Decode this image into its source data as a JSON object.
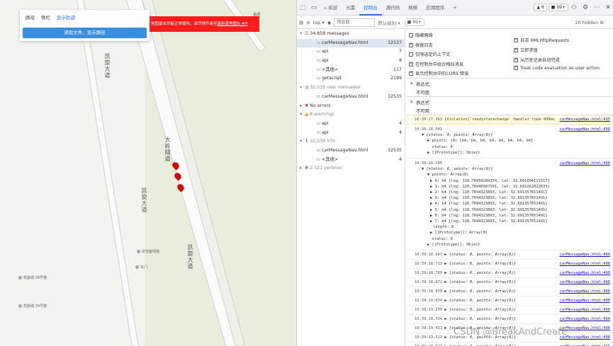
{
  "map": {
    "tabs": [
      "路径",
      "侧栏",
      "显示轨迹"
    ],
    "read_button": "读取文件，显示路径",
    "notice": "地图基本功能正常使用，请尽快升级至",
    "notice_link": "最新版地图JS API",
    "notice_close": "关闭",
    "road_labels": [
      "凯旋大道",
      "大岭隧道",
      "凯旋大道",
      "凯旋大道"
    ],
    "places": [
      "武当客情馆",
      "东门",
      "凯旋城-38号楼",
      "凯旋城-39号楼"
    ]
  },
  "devtools": {
    "tabs": [
      {
        "icon": "inspect-icon",
        "label": ""
      },
      {
        "icon": "device-icon",
        "label": ""
      },
      {
        "icon": "home-icon",
        "label": "欢迎"
      },
      {
        "icon": "",
        "label": "元素"
      },
      {
        "icon": "",
        "label": "控制台"
      },
      {
        "icon": "",
        "label": "源代码"
      },
      {
        "icon": "",
        "label": "网络"
      },
      {
        "icon": "",
        "label": "应用程序"
      },
      {
        "icon": "plus-icon",
        "label": "+"
      }
    ],
    "warn_count": "8",
    "info_count": "99+",
    "toolbar": {
      "context": "top",
      "filter_placeholder": "筛选器",
      "levels": "默认级别",
      "issues": "99+",
      "hidden": "20 hidden"
    },
    "sidebar": [
      {
        "icon": "list-icon",
        "label": "34,858 messages",
        "count": "",
        "level": 0,
        "expanded": true,
        "muted": false
      },
      {
        "icon": "file-icon",
        "label": "carMessageNav.html",
        "count": "32537",
        "level": 1,
        "sel": true
      },
      {
        "icon": "file-icon",
        "label": "api",
        "count": "7",
        "level": 1
      },
      {
        "icon": "file-icon",
        "label": "api",
        "count": "8",
        "level": 1
      },
      {
        "icon": "file-icon",
        "label": "<其他>",
        "count": "117",
        "level": 1
      },
      {
        "icon": "file-icon",
        "label": "getscript",
        "count": "2199",
        "level": 1
      },
      {
        "icon": "user-icon",
        "label": "32,535 user messages",
        "count": "",
        "level": 0,
        "expanded": true,
        "muted": true
      },
      {
        "icon": "file-icon",
        "label": "carMessageNav.html",
        "count": "32535",
        "level": 1
      },
      {
        "icon": "error-icon",
        "label": "No errors",
        "count": "",
        "level": 0
      },
      {
        "icon": "warning-icon",
        "label": "8 warnings",
        "count": "",
        "level": 0,
        "expanded": true,
        "muted": true
      },
      {
        "icon": "file-icon",
        "label": "api",
        "count": "4",
        "level": 1
      },
      {
        "icon": "file-icon",
        "label": "api",
        "count": "4",
        "level": 1
      },
      {
        "icon": "info-icon",
        "label": "32,539 info",
        "count": "",
        "level": 0,
        "expanded": true,
        "muted": true
      },
      {
        "icon": "file-icon",
        "label": "carMessageNav.html",
        "count": "32535",
        "level": 1
      },
      {
        "icon": "file-icon",
        "label": "<其他>",
        "count": "4",
        "level": 1
      },
      {
        "icon": "verbose-icon",
        "label": "2,321 verbose",
        "count": "",
        "level": 0,
        "muted": true
      }
    ],
    "settings": {
      "left": [
        {
          "label": "隐藏网络",
          "checked": false
        },
        {
          "label": "保留日志",
          "checked": true
        },
        {
          "label": "仅限选定的上下文",
          "checked": false
        },
        {
          "label": "在控制台中组合相似消息",
          "checked": true
        },
        {
          "label": "显示控制台中的CORS 错误",
          "checked": true
        }
      ],
      "right": [
        {
          "label": "日志 XMLHttpRequests",
          "checked": true
        },
        {
          "label": "立即求值",
          "checked": true
        },
        {
          "label": "从历史记录自动完成",
          "checked": true
        },
        {
          "label": "Treat code evaluation as user action",
          "checked": true
        }
      ]
    },
    "expressions": [
      {
        "label": "表达式",
        "value": "不可用"
      },
      {
        "label": "表达式",
        "value": "不可用"
      }
    ],
    "console": {
      "violation": {
        "time": "16:39:17.363",
        "text": "[Violation]`readystatechange` handler took 999ms",
        "src": "carMessageNav.html:415"
      },
      "entry1": {
        "time": "16:39:18.501",
        "src": "carMessageNav.html:496",
        "summary": "{status: 0, points: Array(8)}",
        "points_line": "points: (8) [b4, b4, b4, b4, b4, b4, b4, b4]",
        "status_line": "status: 0",
        "proto_line": "[[Prototype]]: Object"
      },
      "entry2": {
        "time": "16:39:18.585",
        "src": "carMessageNav.html:496",
        "summary": "{status: 0, points: Array(8)}",
        "points_head": "points: Array(8)",
        "points": [
          "0: b4 {lng: 110.76950289174, lat: 32.691094111517}",
          "1: b4 {lng: 110.76946587591, lat: 32.691262022633}",
          "2: b4 {lng: 110.7694323893, lat: 32.691357651491}",
          "3: b4 {lng: 110.7694323893, lat: 32.691357651491}",
          "4: b4 {lng: 110.7694323893, lat: 32.691357651491}",
          "5: b4 {lng: 110.7694323893, lat: 32.691357651491}",
          "6: b4 {lng: 110.7694323893, lat: 32.691357651491}",
          "7: b4 {lng: 110.7694323893, lat: 32.691357651491}"
        ],
        "length_line": "length: 8",
        "arr_proto": "[[Prototype]]: Array(0)",
        "status_line": "status: 0",
        "proto_line": "[[Prototype]]: Object"
      },
      "collapsed": [
        {
          "time": "16:39:18.647",
          "text": "{status: 0, points: Array(8)}",
          "src": "carMessageNav.html:496"
        },
        {
          "time": "16:39:18.713",
          "text": "{status: 0, points: Array(8)}",
          "src": "carMessageNav.html:496"
        },
        {
          "time": "16:39:18.789",
          "text": "{status: 0, points: Array(8)}",
          "src": "carMessageNav.html:496"
        },
        {
          "time": "16:39:18.872",
          "text": "{status: 0, points: Array(8)}",
          "src": "carMessageNav.html:496"
        },
        {
          "time": "16:39:18.950",
          "text": "{status: 0, points: Array(8)}",
          "src": "carMessageNav.html:496"
        },
        {
          "time": "16:39:19.034",
          "text": "{status: 0, points: Array(8)}",
          "src": "carMessageNav.html:496"
        },
        {
          "time": "16:39:19.200",
          "text": "{status: 0, points: Array(8)}",
          "src": "carMessageNav.html:496"
        },
        {
          "time": "16:39:19.334",
          "text": "{status: 0, points: Array(8)}",
          "src": "carMessageNav.html:496"
        },
        {
          "time": "16:39:19.433",
          "text": "{status: 0, points: Array(8)}",
          "src": "carMessageNav.html:496"
        },
        {
          "time": "16:39:19.523",
          "text": "{status: 0, points: Array(8)}",
          "src": "carMessageNav.html:496"
        },
        {
          "time": "16:39:19.627",
          "text": "{status: 0, points: Array(8)}",
          "src": "carMessageNav.html:496"
        },
        {
          "time": "16:39:19.754",
          "text": "{status: 0, points: Array(8)}",
          "src": "carMessageNav.html:496"
        }
      ]
    }
  },
  "watermark": "CSDN @BreakAndCreate"
}
